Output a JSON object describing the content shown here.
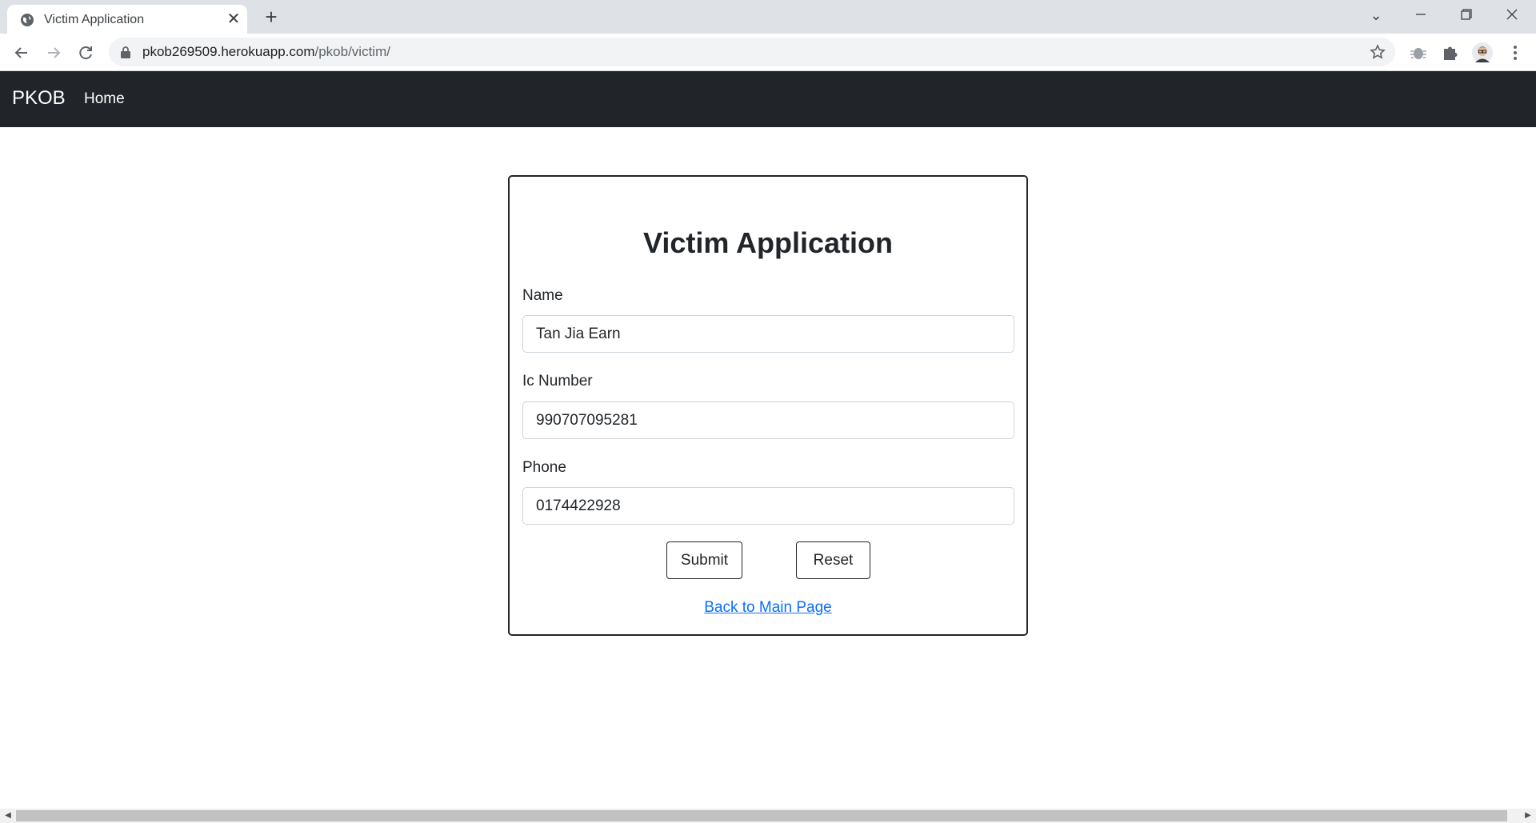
{
  "browser": {
    "tab_title": "Victim Application",
    "url_host": "pkob269509.herokuapp.com",
    "url_path": "/pkob/victim/"
  },
  "site": {
    "brand": "PKOB",
    "nav_home": "Home"
  },
  "form": {
    "title": "Victim Application",
    "name_label": "Name",
    "name_value": "Tan Jia Earn",
    "ic_label": "Ic Number",
    "ic_value": "990707095281",
    "phone_label": "Phone",
    "phone_value": "0174422928",
    "submit_label": "Submit",
    "reset_label": "Reset",
    "back_link": "Back to Main Page"
  },
  "colors": {
    "navbar_bg": "#212529",
    "link": "#0d6efd"
  }
}
